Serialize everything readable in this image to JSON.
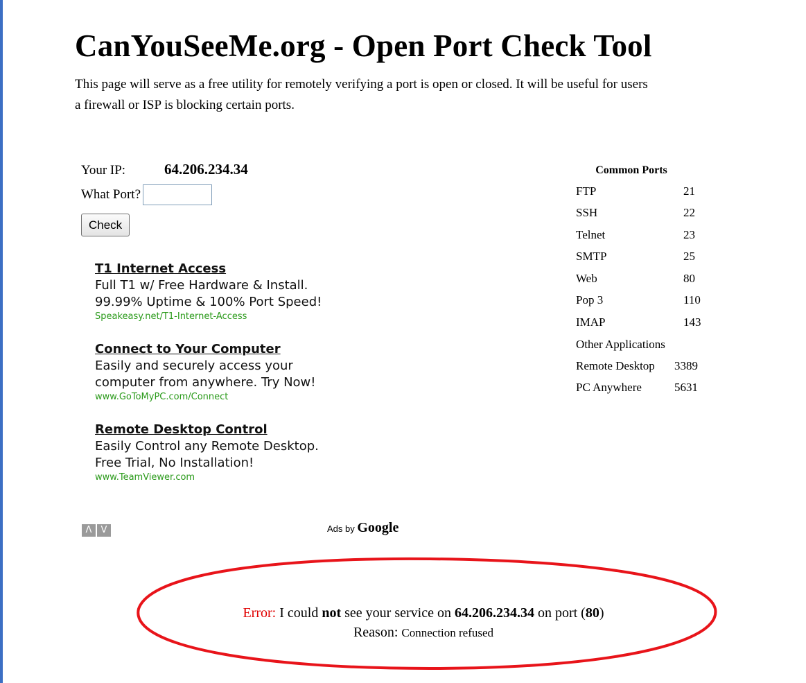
{
  "header": {
    "title": "CanYouSeeMe.org - Open Port Check Tool",
    "intro_line1": "This page will serve as a free utility for remotely verifying a port is open or closed. It will be useful for users",
    "intro_line2": "a firewall or ISP is blocking certain ports."
  },
  "form": {
    "ip_label": "Your IP:",
    "ip_value": "64.206.234.34",
    "port_label": "What Port?",
    "port_value": "",
    "check_label": "Check"
  },
  "ads": [
    {
      "title": "T1 Internet Access",
      "line1": "Full T1 w/ Free Hardware & Install.",
      "line2": "99.99% Uptime & 100% Port Speed!",
      "url": "Speakeasy.net/T1-Internet-Access"
    },
    {
      "title": "Connect to Your Computer",
      "line1": "Easily and securely access your",
      "line2": "computer from anywhere. Try Now!",
      "url": "www.GoToMyPC.com/Connect"
    },
    {
      "title": "Remote Desktop Control",
      "line1": "Easily Control any Remote Desktop.",
      "line2": "Free Trial, No Installation!",
      "url": "www.TeamViewer.com"
    }
  ],
  "ad_nav": {
    "prev": "Λ",
    "next": "V"
  },
  "ads_by": {
    "prefix": "Ads by",
    "brand": "Google"
  },
  "common_ports": {
    "title": "Common Ports",
    "items": [
      {
        "name": "FTP",
        "port": "21"
      },
      {
        "name": "SSH",
        "port": "22"
      },
      {
        "name": "Telnet",
        "port": "23"
      },
      {
        "name": "SMTP",
        "port": "25"
      },
      {
        "name": "Web",
        "port": "80"
      },
      {
        "name": "Pop 3",
        "port": "110"
      },
      {
        "name": "IMAP",
        "port": "143"
      }
    ],
    "other_label": "Other Applications",
    "other_items": [
      {
        "name": "Remote Desktop",
        "port": "3389"
      },
      {
        "name": "PC Anywhere",
        "port": "5631"
      }
    ]
  },
  "result": {
    "error_label": "Error:",
    "text_a": "I could",
    "text_not": "not",
    "text_b": "see your service on",
    "ip": "64.206.234.34",
    "text_c": "on port (",
    "port": "80",
    "text_d": ")",
    "reason_label": "Reason:",
    "reason_value": "Connection refused"
  },
  "colors": {
    "error_red": "#e00000",
    "ad_url_green": "#2a9a1a",
    "oval_red": "#e8141a",
    "left_rule_blue": "#3c6fc4"
  }
}
